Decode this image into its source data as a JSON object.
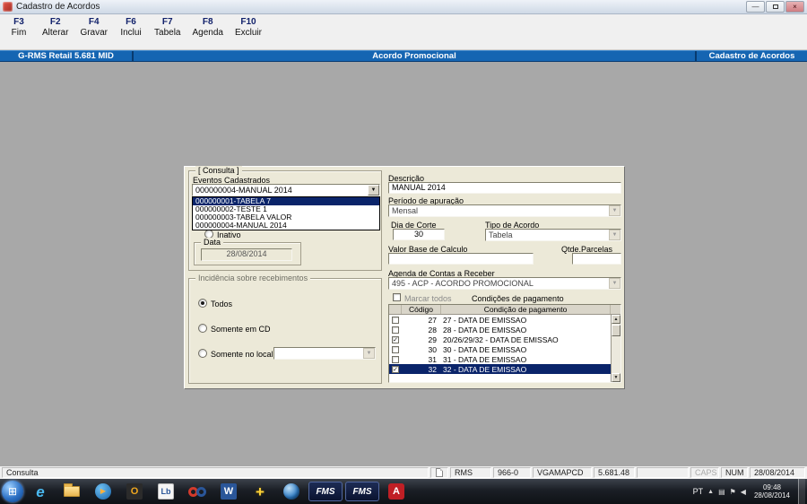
{
  "window": {
    "title": "Cadastro de Acordos"
  },
  "toolbar": {
    "items": [
      {
        "key": "F3",
        "label": "Fim"
      },
      {
        "key": "F2",
        "label": "Alterar"
      },
      {
        "key": "F4",
        "label": "Gravar"
      },
      {
        "key": "F6",
        "label": "Inclui"
      },
      {
        "key": "F7",
        "label": "Tabela"
      },
      {
        "key": "F8",
        "label": "Agenda"
      },
      {
        "key": "F10",
        "label": "Excluir"
      }
    ]
  },
  "header": {
    "left": "G-RMS Retail 5.681 MID",
    "center": "Acordo Promocional",
    "right": "Cadastro de Acordos"
  },
  "form": {
    "group_title": "[ Consulta ]",
    "eventos": {
      "label": "Eventos Cadastrados",
      "value": "000000004-MANUAL 2014",
      "options": [
        {
          "text": "000000001-TABELA 7",
          "selected": true
        },
        {
          "text": "000000002-TESTE 1",
          "selected": false
        },
        {
          "text": "000000003-TABELA VALOR",
          "selected": false
        },
        {
          "text": "000000004-MANUAL 2014",
          "selected": false
        }
      ]
    },
    "inativo_label": "Inativo",
    "data": {
      "label": "Data",
      "value": "28/08/2014"
    },
    "descricao": {
      "label": "Descrição",
      "value": "MANUAL 2014"
    },
    "periodo": {
      "label": "Período de apuração",
      "value": "Mensal"
    },
    "dia_corte": {
      "label": "Dia de Corte",
      "value": "30"
    },
    "tipo_acordo": {
      "label": "Tipo de Acordo",
      "value": "Tabela"
    },
    "valor_base": {
      "label": "Valor Base de Calculo",
      "value": ""
    },
    "qtde_parcelas": {
      "label": "Qtde.Parcelas",
      "value": ""
    },
    "agenda": {
      "label": "Agenda de Contas a Receber",
      "value": "495 - ACP - ACORDO PROMOCIONAL"
    },
    "marcar_todos_label": "Marcar todos",
    "condicoes_label": "Condições de pagamento",
    "grid": {
      "columns": [
        "Código",
        "Condição de pagamento"
      ],
      "rows": [
        {
          "checked": false,
          "codigo": "27",
          "condicao": "27 - DATA DE EMISSAO",
          "selected": false
        },
        {
          "checked": false,
          "codigo": "28",
          "condicao": "28 - DATA DE EMISSAO",
          "selected": false
        },
        {
          "checked": true,
          "codigo": "29",
          "condicao": "20/26/29/32 - DATA DE EMISSAO",
          "selected": false
        },
        {
          "checked": false,
          "codigo": "30",
          "condicao": "30 - DATA DE EMISSAO",
          "selected": false
        },
        {
          "checked": false,
          "codigo": "31",
          "condicao": "31 - DATA DE EMISSAO",
          "selected": false
        },
        {
          "checked": true,
          "codigo": "32",
          "condicao": "32 - DATA DE EMISSAO",
          "selected": true
        }
      ]
    },
    "incidencia": {
      "title": "Incidência sobre recebimentos",
      "options": [
        {
          "label": "Todos",
          "selected": true
        },
        {
          "label": "Somente em CD",
          "selected": false
        },
        {
          "label": "Somente no local",
          "selected": false
        }
      ],
      "local_combo_value": ""
    }
  },
  "statusbar": {
    "mode": "Consulta",
    "cells": [
      "RMS",
      "966-0",
      "VGAMAPCD",
      "5.681.48"
    ],
    "caps": "CAPS",
    "num": "NUM",
    "date": "28/08/2014"
  },
  "taskbar": {
    "fms_label": "FMS",
    "tray": {
      "lang": "PT",
      "time": "09:48",
      "date": "28/08/2014"
    }
  },
  "colors": {
    "header_blue": "#1565b2",
    "selection_navy": "#0a246a",
    "form_bg": "#ece9d8"
  },
  "icons": {
    "dropdown_arrow": "▼",
    "scroll_up": "▲",
    "scroll_down": "▼",
    "check": "✓",
    "minimize": "—",
    "close": "×",
    "start_flag": "⊞",
    "ie": "e",
    "outlook": "O",
    "word": "W",
    "lb": "Lb",
    "plus": "+",
    "play": "▶",
    "adobe": "A",
    "tray_expand": "▲",
    "tray_grid": "▤",
    "tray_flag": "⚑",
    "tray_volume": "◀"
  }
}
